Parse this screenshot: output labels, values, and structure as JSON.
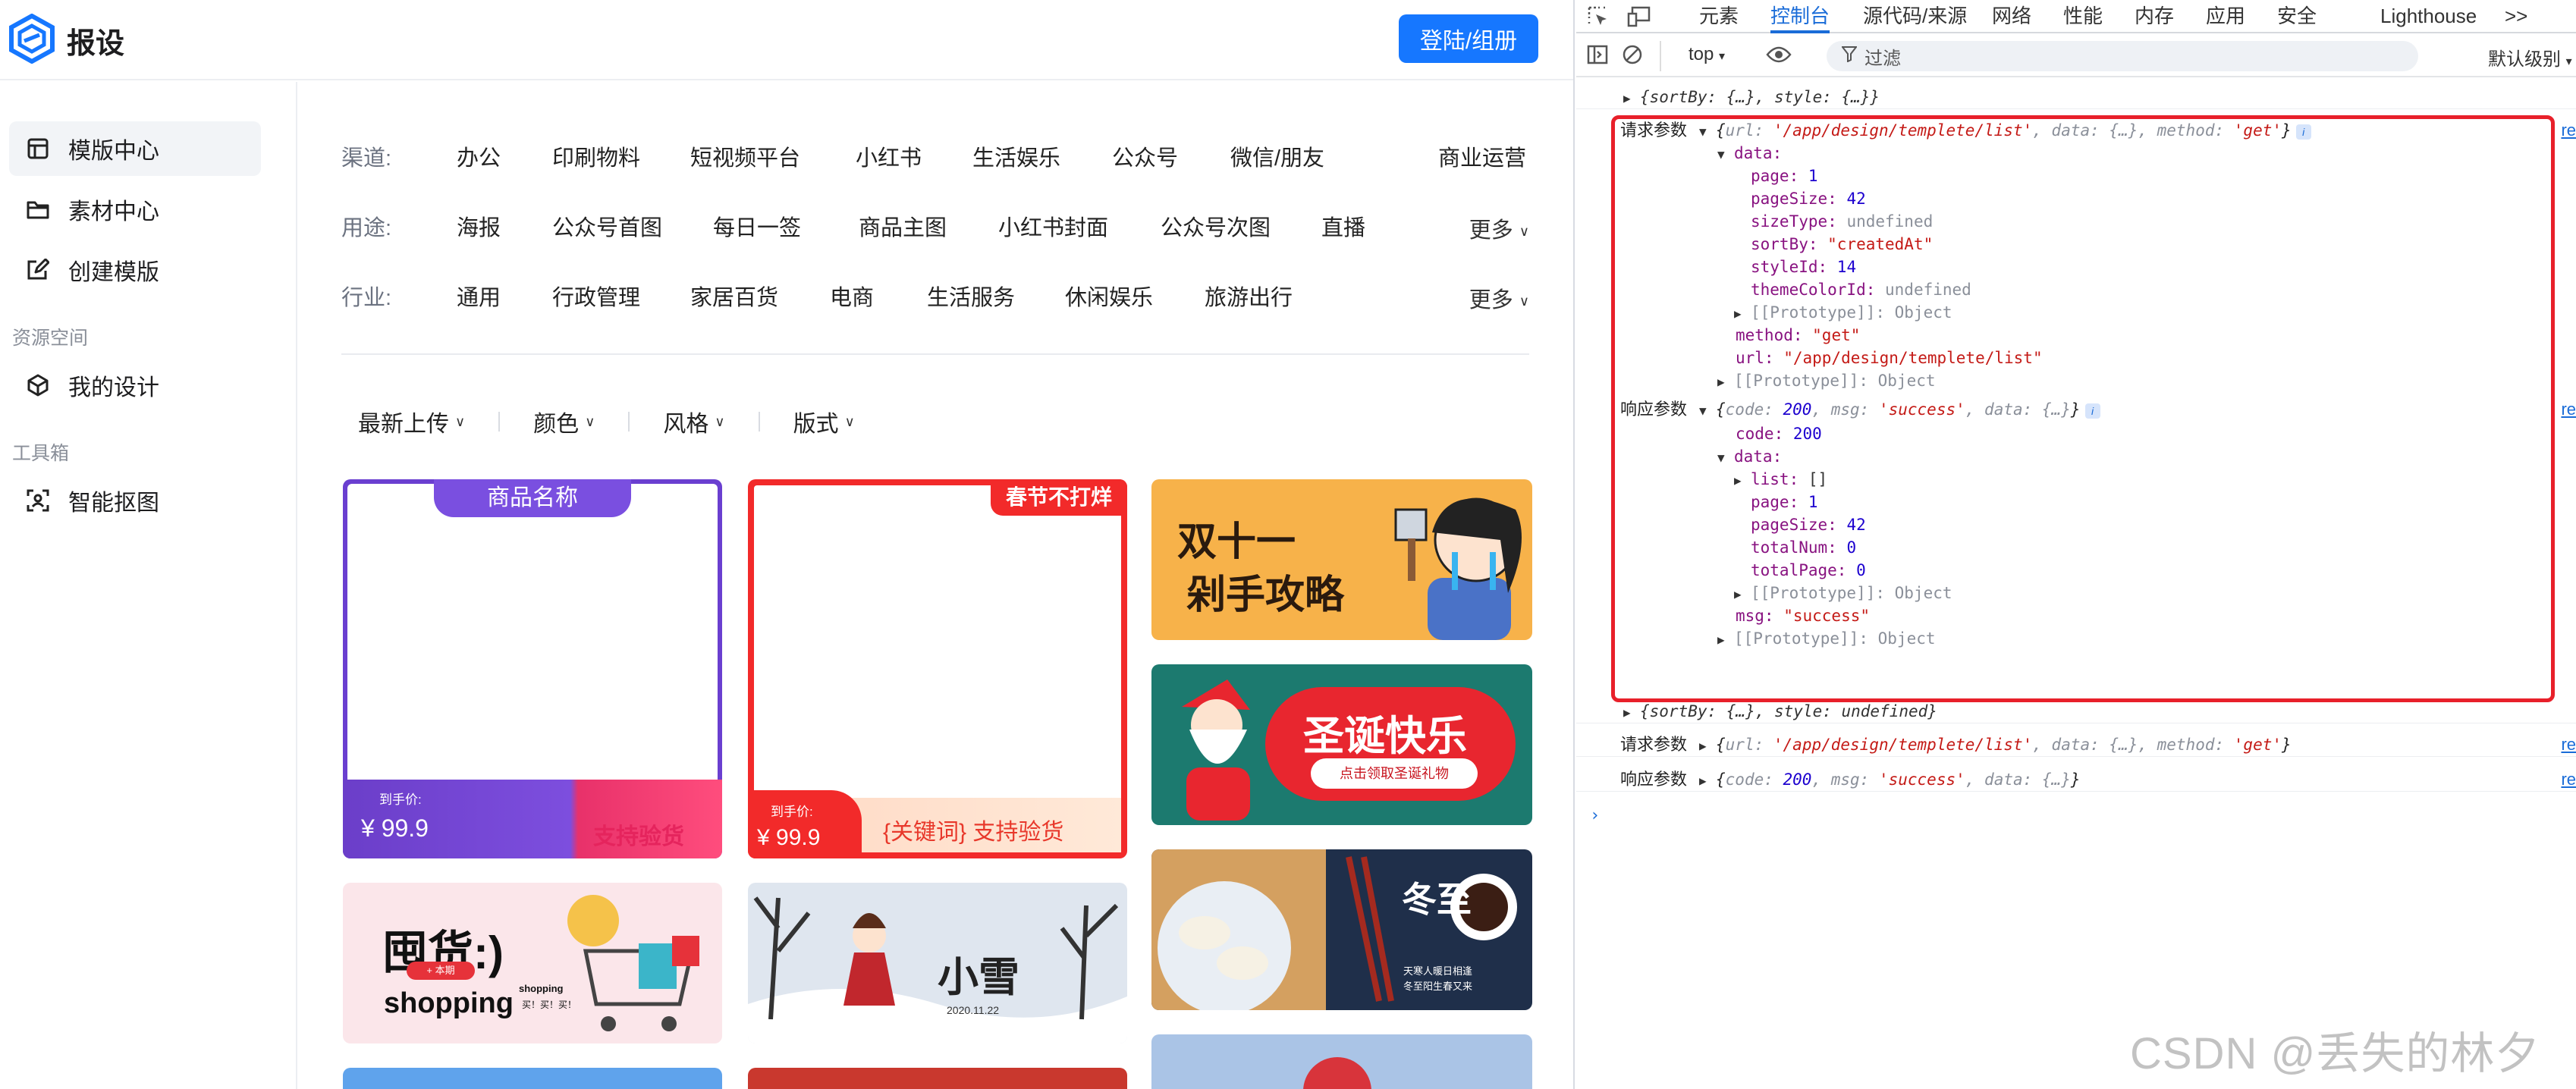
{
  "app": {
    "brand": "报设",
    "login_label": "登陆/组册",
    "sidebar": {
      "items": [
        {
          "label": "模版中心",
          "icon": "template-icon"
        },
        {
          "label": "素材中心",
          "icon": "folder-icon"
        },
        {
          "label": "创建模版",
          "icon": "edit-icon"
        }
      ],
      "section_resource": "资源空间",
      "resource_items": [
        {
          "label": "我的设计",
          "icon": "cube-icon"
        }
      ],
      "section_tools": "工具箱",
      "tool_items": [
        {
          "label": "智能抠图",
          "icon": "scan-icon"
        }
      ]
    },
    "filters": {
      "channel": {
        "label": "渠道:",
        "options": [
          "办公",
          "印刷物料",
          "短视频平台",
          "小红书",
          "生活娱乐",
          "公众号",
          "微信/朋友",
          "商业运营"
        ]
      },
      "usage": {
        "label": "用途:",
        "options": [
          "海报",
          "公众号首图",
          "每日一签",
          "商品主图",
          "小红书封面",
          "公众号次图",
          "直播"
        ],
        "more": "更多"
      },
      "industry": {
        "label": "行业:",
        "options": [
          "通用",
          "行政管理",
          "家居百货",
          "电商",
          "生活服务",
          "休闲娱乐",
          "旅游出行"
        ],
        "more": "更多"
      }
    },
    "sort": [
      "最新上传",
      "颜色",
      "风格",
      "版式"
    ],
    "cards": {
      "product": {
        "title": "商品名称",
        "price_label": "到手价:",
        "price": "¥ 99.9",
        "badge": "支持验货"
      },
      "festival": {
        "corner": "春节不打烊",
        "price_label": "到手价:",
        "price": "¥ 99.9",
        "keyword": "{关键词} 支持验货"
      },
      "double11": {
        "line1": "双十一",
        "line2": "剁手攻略"
      },
      "christmas": {
        "title": "圣诞快乐",
        "sub": "点击领取圣诞礼物"
      },
      "shopping": {
        "title": "囤货:)",
        "sub": "shopping",
        "small": "shopping",
        "small2": "买！买！买！",
        "tag": "+ 本期"
      },
      "snow": {
        "title": "小雪",
        "date": "2020.11.22"
      },
      "winter": {
        "title": "冬至",
        "sub1": "天寒人暖日相逢",
        "sub2": "冬至阳生春又来"
      }
    }
  },
  "devtools": {
    "tabs": [
      "元素",
      "控制台",
      "源代码/来源",
      "网络",
      "性能",
      "内存",
      "应用",
      "安全",
      "Lighthouse",
      ">>"
    ],
    "active_tab": "控制台",
    "context": "top",
    "filter_placeholder": "过滤",
    "level": "默认级别",
    "lines": {
      "l0": "{sortBy: {…}, style: {…}}",
      "req_label": "请求参数",
      "req_summary_url_key": "url:",
      "req_summary_url": "'/app/design/templete/list'",
      "req_summary_rest": ", data: {…}, method: ",
      "req_summary_method": "'get'",
      "data_key": "data:",
      "page": "1",
      "pageSize": "42",
      "sizeType": "undefined",
      "sortBy": "\"createdAt\"",
      "styleId": "14",
      "themeColorId": "undefined",
      "prototype": "[[Prototype]]: Object",
      "method": "\"get\"",
      "url": "\"/app/design/templete/list\"",
      "res_label": "响应参数",
      "res_code": "200",
      "res_msg": "'success'",
      "list": "[]",
      "totalNum": "0",
      "totalPage": "0",
      "msg": "\"success\"",
      "l_after": "{sortBy: {…}, style: undefined}"
    },
    "src_link": "re"
  },
  "watermark": "CSDN @丢失的林夕"
}
